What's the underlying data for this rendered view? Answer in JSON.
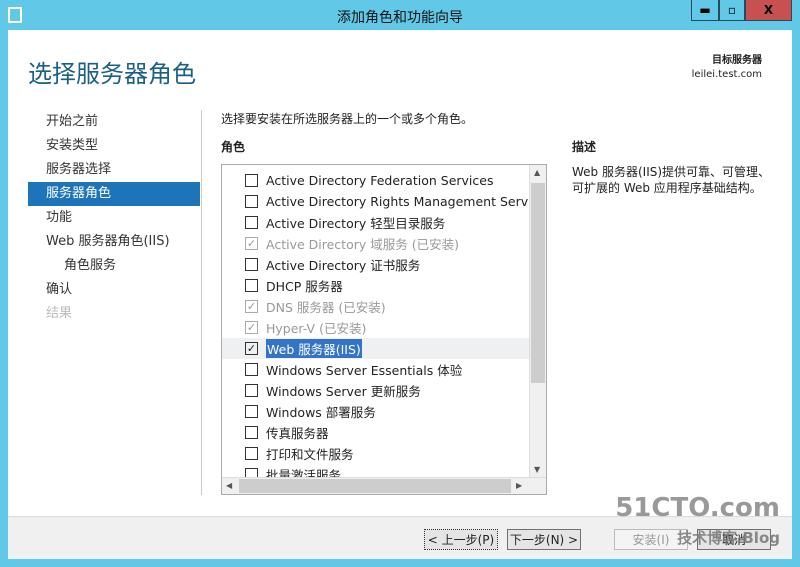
{
  "window": {
    "title": "添加角色和功能向导",
    "minimize": "▬",
    "maximize": "▫",
    "close": "X"
  },
  "page_title": "选择服务器角色",
  "target": {
    "label": "目标服务器",
    "server": "leilei.test.com"
  },
  "nav": [
    {
      "label": "开始之前",
      "state": "normal"
    },
    {
      "label": "安装类型",
      "state": "normal"
    },
    {
      "label": "服务器选择",
      "state": "normal"
    },
    {
      "label": "服务器角色",
      "state": "active"
    },
    {
      "label": "功能",
      "state": "normal"
    },
    {
      "label": "Web 服务器角色(IIS)",
      "state": "normal"
    },
    {
      "label": "角色服务",
      "state": "sub"
    },
    {
      "label": "确认",
      "state": "normal"
    },
    {
      "label": "结果",
      "state": "disabled"
    }
  ],
  "instruction": "选择要安装在所选服务器上的一个或多个角色。",
  "roles_header": "角色",
  "description_header": "描述",
  "roles": [
    {
      "label": "Active Directory Federation Services",
      "checked": false,
      "disabled": false
    },
    {
      "label": "Active Directory Rights Management Services",
      "checked": false,
      "disabled": false
    },
    {
      "label": "Active Directory 轻型目录服务",
      "checked": false,
      "disabled": false
    },
    {
      "label": "Active Directory 域服务 (已安装)",
      "checked": true,
      "disabled": true
    },
    {
      "label": "Active Directory 证书服务",
      "checked": false,
      "disabled": false
    },
    {
      "label": "DHCP 服务器",
      "checked": false,
      "disabled": false
    },
    {
      "label": "DNS 服务器 (已安装)",
      "checked": true,
      "disabled": true
    },
    {
      "label": "Hyper-V (已安装)",
      "checked": true,
      "disabled": true
    },
    {
      "label": "Web 服务器(IIS)",
      "checked": true,
      "disabled": false,
      "selected": true
    },
    {
      "label": "Windows Server Essentials 体验",
      "checked": false,
      "disabled": false
    },
    {
      "label": "Windows Server 更新服务",
      "checked": false,
      "disabled": false
    },
    {
      "label": "Windows 部署服务",
      "checked": false,
      "disabled": false
    },
    {
      "label": "传真服务器",
      "checked": false,
      "disabled": false
    },
    {
      "label": "打印和文件服务",
      "checked": false,
      "disabled": false
    },
    {
      "label": "批量激活服务",
      "checked": false,
      "disabled": false
    }
  ],
  "description": "Web 服务器(IIS)提供可靠、可管理、可扩展的 Web 应用程序基础结构。",
  "buttons": {
    "prev": "< 上一步(P)",
    "next": "下一步(N) >",
    "install": "安装(I)",
    "cancel": "取消"
  },
  "watermark": {
    "brand": "51CTO.com",
    "sub": "技术博客 Blog"
  }
}
